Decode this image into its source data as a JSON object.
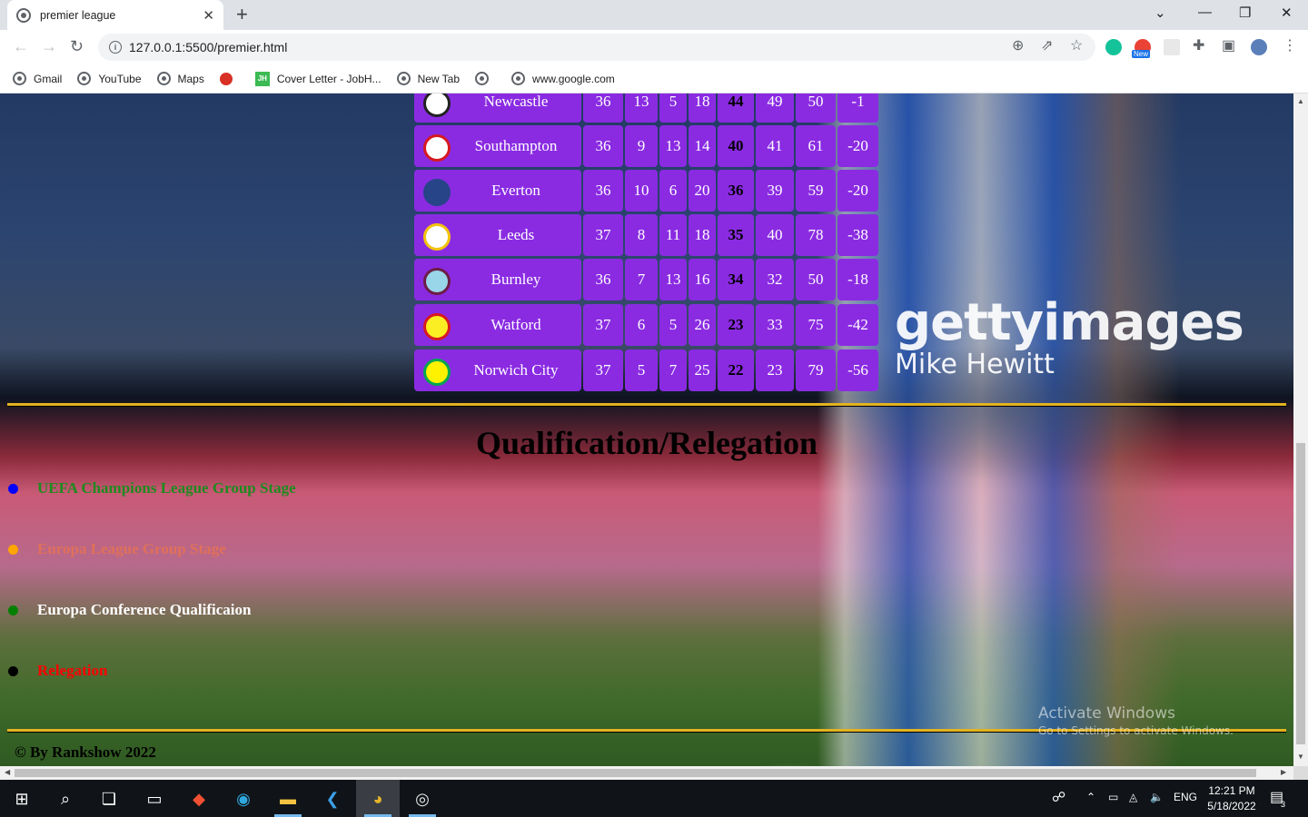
{
  "browser": {
    "tab_title": "premier league",
    "tab_close": "✕",
    "new_tab": "+",
    "url": "127.0.0.1:5500/premier.html",
    "bookmarks": [
      {
        "label": "Gmail",
        "icon": "globe-icon"
      },
      {
        "label": "YouTube",
        "icon": "globe-icon"
      },
      {
        "label": "Maps",
        "icon": "globe-icon"
      },
      {
        "label": "",
        "icon": "red-dot-icon"
      },
      {
        "label": "Cover Letter - JobH...",
        "icon": "jh-icon"
      },
      {
        "label": "New Tab",
        "icon": "globe-icon"
      },
      {
        "label": "",
        "icon": "globe-icon"
      },
      {
        "label": "www.google.com",
        "icon": "globe-icon"
      }
    ],
    "ext_badge": "New"
  },
  "table": {
    "rows": [
      {
        "team": "Newcastle",
        "c1": "36",
        "c2": "13",
        "c3": "5",
        "c4": "18",
        "pts": "44",
        "c6": "49",
        "c7": "50",
        "c8": "-1"
      },
      {
        "team": "Southampton",
        "c1": "36",
        "c2": "9",
        "c3": "13",
        "c4": "14",
        "pts": "40",
        "c6": "41",
        "c7": "61",
        "c8": "-20"
      },
      {
        "team": "Everton",
        "c1": "36",
        "c2": "10",
        "c3": "6",
        "c4": "20",
        "pts": "36",
        "c6": "39",
        "c7": "59",
        "c8": "-20"
      },
      {
        "team": "Leeds",
        "c1": "37",
        "c2": "8",
        "c3": "11",
        "c4": "18",
        "pts": "35",
        "c6": "40",
        "c7": "78",
        "c8": "-38"
      },
      {
        "team": "Burnley",
        "c1": "36",
        "c2": "7",
        "c3": "13",
        "c4": "16",
        "pts": "34",
        "c6": "32",
        "c7": "50",
        "c8": "-18"
      },
      {
        "team": "Watford",
        "c1": "37",
        "c2": "6",
        "c3": "5",
        "c4": "26",
        "pts": "23",
        "c6": "33",
        "c7": "75",
        "c8": "-42"
      },
      {
        "team": "Norwich City",
        "c1": "37",
        "c2": "5",
        "c3": "7",
        "c4": "25",
        "pts": "22",
        "c6": "23",
        "c7": "79",
        "c8": "-56"
      }
    ]
  },
  "qualification": {
    "heading": "Qualification/Relegation",
    "items": [
      {
        "label": "UEFA Champions League Group Stage",
        "dot_color": "#0000ff",
        "text_color": "#1e8a1e"
      },
      {
        "label": "Europa League Group Stage",
        "dot_color": "#ffa500",
        "text_color": "#e0705a"
      },
      {
        "label": "Europa Conference Qualificaion",
        "dot_color": "#008000",
        "text_color": "#ffffff"
      },
      {
        "label": "Relegation",
        "dot_color": "#000000",
        "text_color": "#ff0000"
      }
    ]
  },
  "footer": {
    "text": "© By Rankshow 2022"
  },
  "watermark": {
    "brand": "gettyimages",
    "photographer": "Mike Hewitt"
  },
  "activate": {
    "line1": "Activate Windows",
    "line2": "Go to Settings to activate Windows."
  },
  "taskbar": {
    "lang": "ENG",
    "time": "12:21 PM",
    "date": "5/18/2022",
    "notifications": "3"
  }
}
